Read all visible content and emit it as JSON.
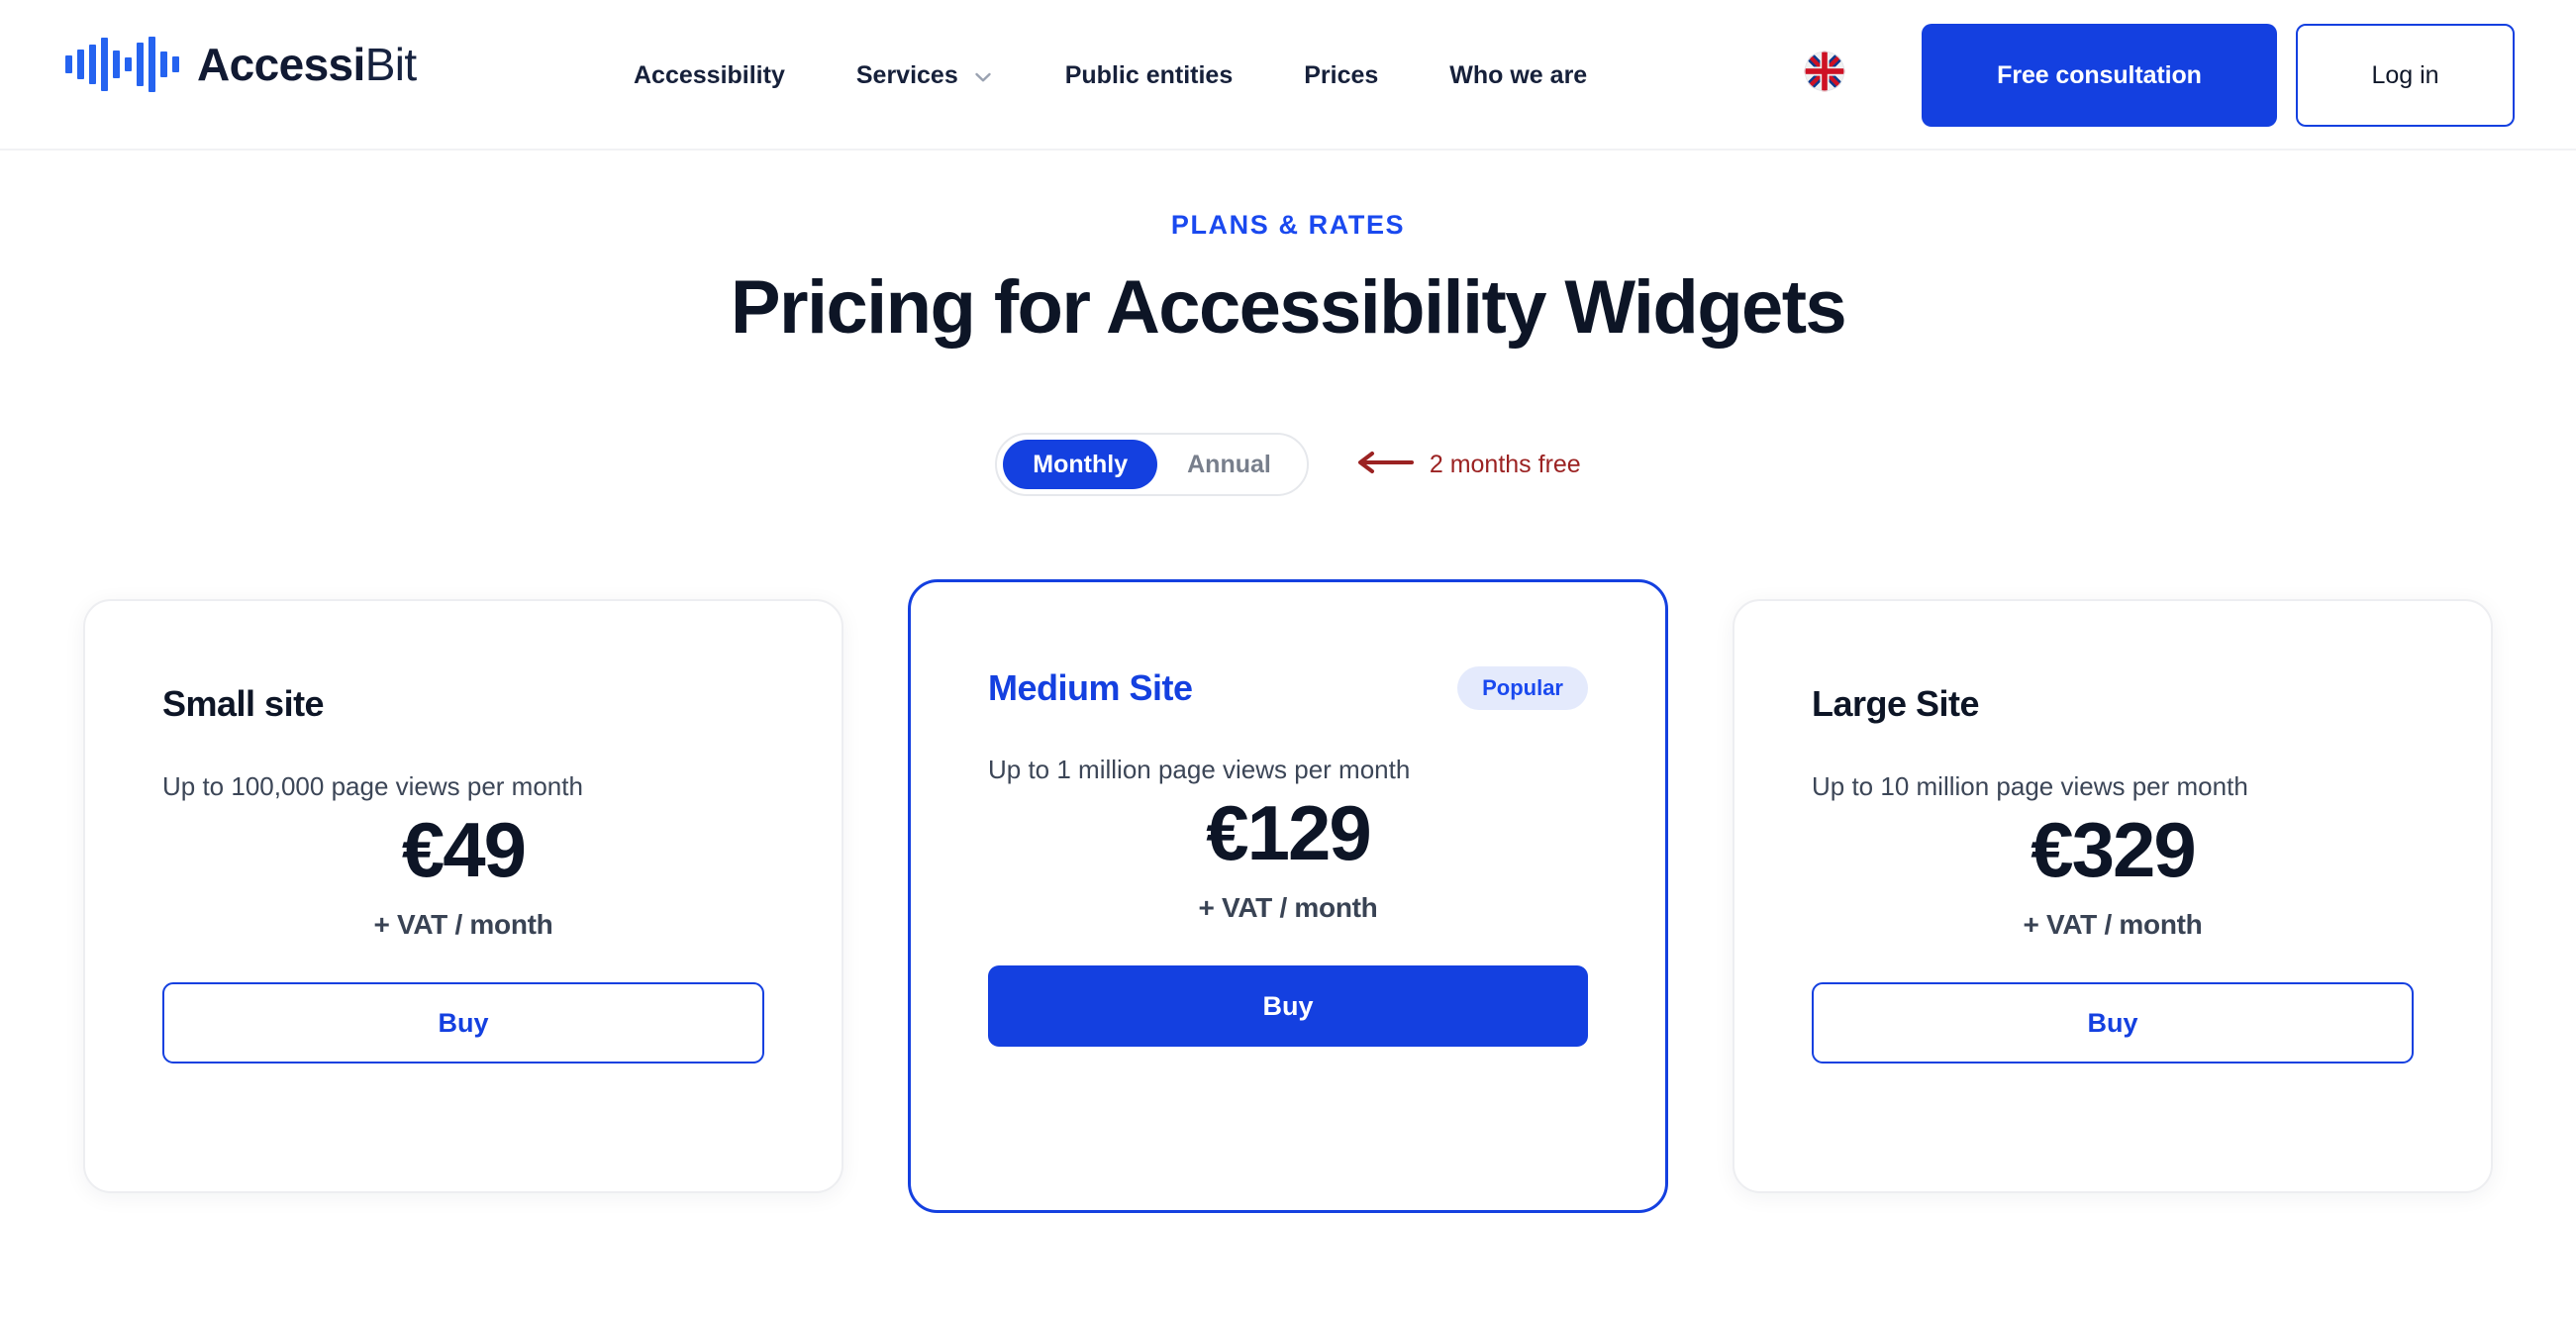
{
  "brand": {
    "name_bold": "Accessi",
    "name_light": "Bit",
    "logo_icon": "waveform-icon",
    "accent_blue": "#1440e0",
    "link_blue": "#1a49ef",
    "ink": "#0d1526",
    "promo_red": "#9b2222",
    "badge_bg": "#e4eafc"
  },
  "header": {
    "nav": [
      {
        "label": "Accessibility",
        "has_dropdown": false
      },
      {
        "label": "Services",
        "has_dropdown": true,
        "dropdown_icon": "chevron-down-icon"
      },
      {
        "label": "Public entities",
        "has_dropdown": false
      },
      {
        "label": "Prices",
        "has_dropdown": false
      },
      {
        "label": "Who we are",
        "has_dropdown": false
      }
    ],
    "language_icon": "uk-flag-icon",
    "cta_label": "Free consultation",
    "login_label": "Log in"
  },
  "hero": {
    "eyebrow": "PLANS & RATES",
    "title": "Pricing for Accessibility Widgets"
  },
  "billing": {
    "options": [
      {
        "label": "Monthly",
        "active": true
      },
      {
        "label": "Annual",
        "active": false
      }
    ],
    "promo_icon": "arrow-left-icon",
    "promo_text": "2 months free"
  },
  "plans": [
    {
      "id": "small",
      "title": "Small site",
      "badge": null,
      "subtitle": "Up to 100,000 page views per month",
      "price": "€49",
      "price_note": "+ VAT / month",
      "cta_label": "Buy",
      "featured": false
    },
    {
      "id": "medium",
      "title": "Medium Site",
      "badge": "Popular",
      "subtitle": "Up to 1 million page views per month",
      "price": "€129",
      "price_note": "+ VAT / month",
      "cta_label": "Buy",
      "featured": true
    },
    {
      "id": "large",
      "title": "Large Site",
      "badge": null,
      "subtitle": "Up to 10 million page views per month",
      "price": "€329",
      "price_note": "+ VAT / month",
      "cta_label": "Buy",
      "featured": false
    }
  ]
}
